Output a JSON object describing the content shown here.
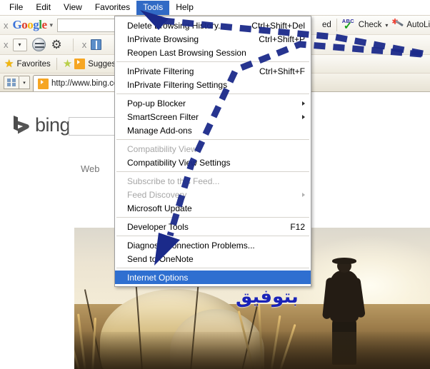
{
  "menubar": {
    "items": [
      {
        "label": "File",
        "active": false
      },
      {
        "label": "Edit",
        "active": false
      },
      {
        "label": "View",
        "active": false
      },
      {
        "label": "Favorites",
        "active": false
      },
      {
        "label": "Tools",
        "active": true
      },
      {
        "label": "Help",
        "active": false
      }
    ]
  },
  "google_toolbar": {
    "close_label": "x",
    "logo_letters": [
      "G",
      "o",
      "o",
      "g",
      "l",
      "e"
    ],
    "dropdown_caret": "▾",
    "search_value": "",
    "search_placeholder": "",
    "right_truncated_label": "ed",
    "check_label": "Check",
    "check_icon_top": "ABC",
    "check_icon_mark": "✓",
    "check_dropdown": "▾",
    "autolink_label": "AutoLi",
    "row2_close_label": "x",
    "row2_caret": "▾",
    "row2_second_close": "x"
  },
  "favorites_bar": {
    "favorites_label": "Favorites",
    "suggested_label": "Sugges"
  },
  "tab_bar": {
    "tab_title": "http://www.bing.com",
    "tablist_caret": "▾"
  },
  "page": {
    "bing_wordmark": "bing",
    "search_value": "",
    "web_link": "Web",
    "arabic_watermark": "بتوفيق"
  },
  "tools_menu": {
    "items": [
      {
        "label": "Delete Browsing History...",
        "accel": "Ctrl+Shift+Del",
        "disabled": false,
        "submenu": false,
        "selected": false
      },
      {
        "label": "InPrivate Browsing",
        "accel": "Ctrl+Shift+P",
        "disabled": false,
        "submenu": false,
        "selected": false
      },
      {
        "label": "Reopen Last Browsing Session",
        "accel": "",
        "disabled": false,
        "submenu": false,
        "selected": false
      },
      {
        "separator": true
      },
      {
        "label": "InPrivate Filtering",
        "accel": "Ctrl+Shift+F",
        "disabled": false,
        "submenu": false,
        "selected": false
      },
      {
        "label": "InPrivate Filtering Settings",
        "accel": "",
        "disabled": false,
        "submenu": false,
        "selected": false
      },
      {
        "separator": true
      },
      {
        "label": "Pop-up Blocker",
        "accel": "",
        "disabled": false,
        "submenu": true,
        "selected": false
      },
      {
        "label": "SmartScreen Filter",
        "accel": "",
        "disabled": false,
        "submenu": true,
        "selected": false
      },
      {
        "label": "Manage Add-ons",
        "accel": "",
        "disabled": false,
        "submenu": false,
        "selected": false
      },
      {
        "separator": true
      },
      {
        "label": "Compatibility View",
        "accel": "",
        "disabled": true,
        "submenu": false,
        "selected": false
      },
      {
        "label": "Compatibility View Settings",
        "accel": "",
        "disabled": false,
        "submenu": false,
        "selected": false
      },
      {
        "separator": true
      },
      {
        "label": "Subscribe to this Feed...",
        "accel": "",
        "disabled": true,
        "submenu": false,
        "selected": false
      },
      {
        "label": "Feed Discovery",
        "accel": "",
        "disabled": true,
        "submenu": true,
        "selected": false
      },
      {
        "label": "Microsoft Update",
        "accel": "",
        "disabled": false,
        "submenu": false,
        "selected": false
      },
      {
        "separator": true
      },
      {
        "label": "Developer Tools",
        "accel": "F12",
        "disabled": false,
        "submenu": false,
        "selected": false
      },
      {
        "separator": true
      },
      {
        "label": "Diagnose Connection Problems...",
        "accel": "",
        "disabled": false,
        "submenu": false,
        "selected": false
      },
      {
        "label": "Send to OneNote",
        "accel": "",
        "disabled": false,
        "submenu": false,
        "selected": false
      },
      {
        "separator": true
      },
      {
        "label": "Internet Options",
        "accel": "",
        "disabled": false,
        "submenu": false,
        "selected": true
      }
    ]
  },
  "annotations": {
    "arrow_color": "#1b2a8a",
    "arrow_1_target": "Tools",
    "arrow_2_target": "Internet Options"
  }
}
